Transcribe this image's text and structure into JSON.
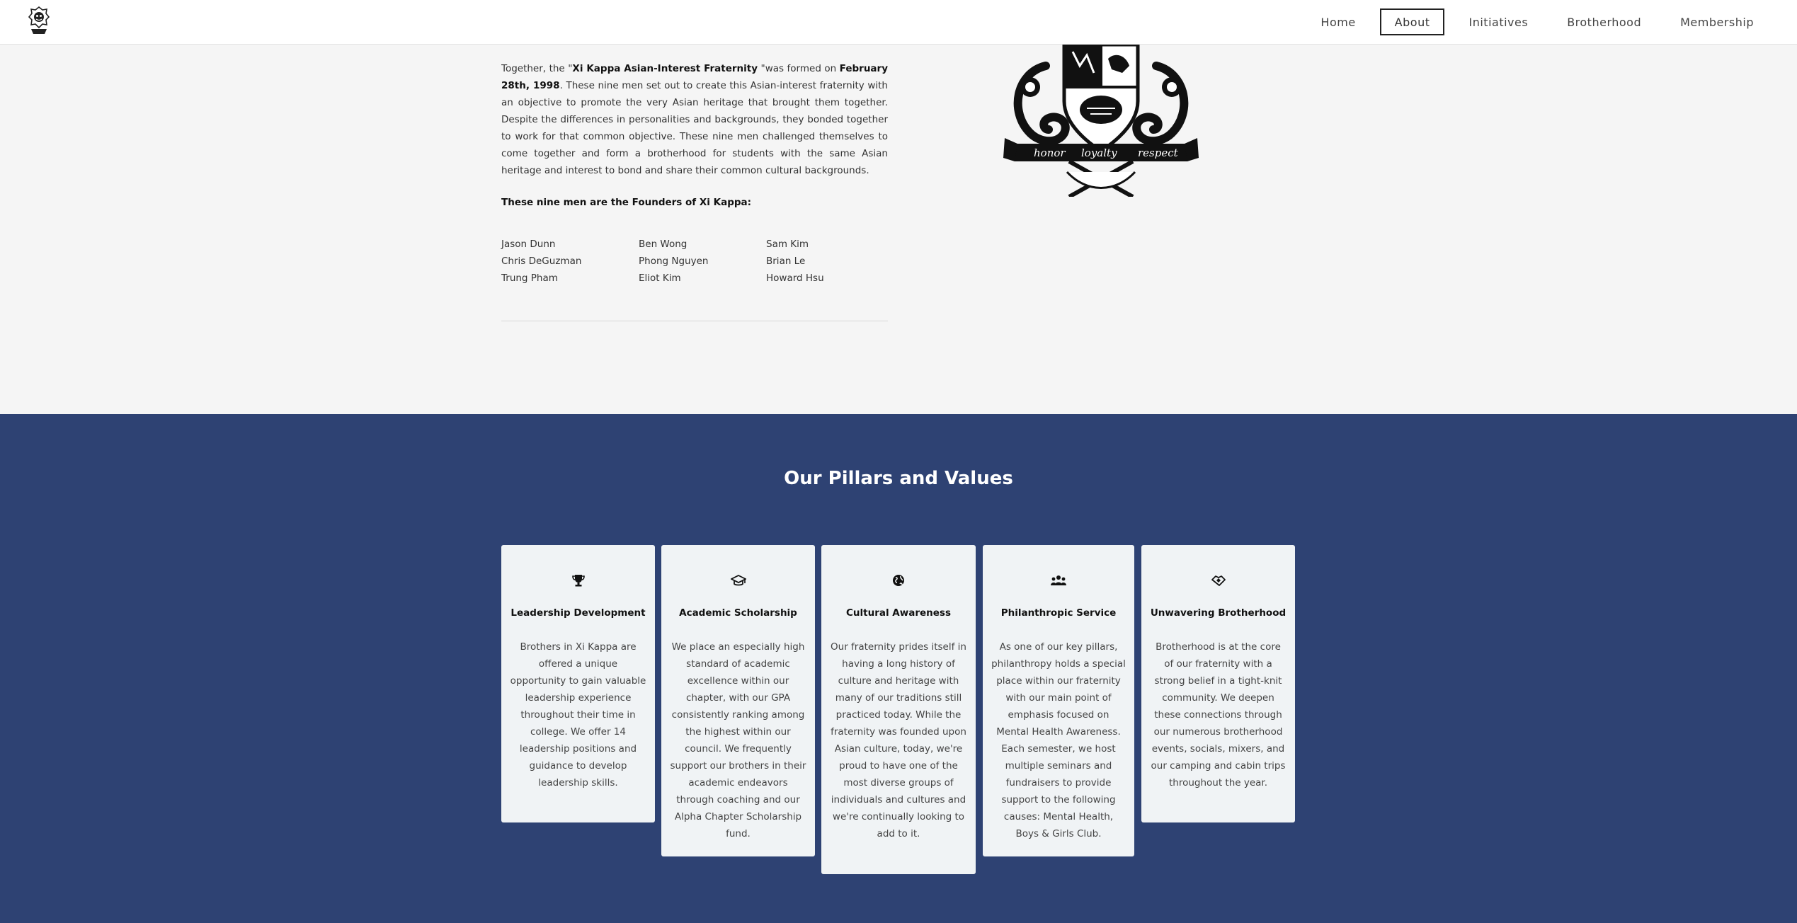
{
  "nav": {
    "items": [
      {
        "label": "Home",
        "active": false
      },
      {
        "label": "About",
        "active": true
      },
      {
        "label": "Initiatives",
        "active": false
      },
      {
        "label": "Brotherhood",
        "active": false
      },
      {
        "label": "Membership",
        "active": false
      }
    ]
  },
  "about": {
    "intro_pre": "Together, the \"",
    "org_name": "Xi Kappa Asian-Interest Fraternity",
    "intro_mid": " \"was formed on ",
    "date": "February 28th, 1998",
    "intro_rest": ". These nine men set out to create this Asian-interest fraternity with an objective to promote the very Asian heritage that brought them together.  Despite the differences in personalities and backgrounds, they bonded together to work for that common objective. These nine men challenged themselves to come together and form a brotherhood for students with the same Asian heritage and interest to bond and share their common cultural backgrounds.",
    "founders_heading": "These nine men are the Founders of Xi Kappa:",
    "founders": [
      "Jason Dunn",
      "Chris DeGuzman",
      "Trung Pham",
      "Ben Wong",
      "Phong Nguyen",
      "Eliot Kim",
      "Sam Kim",
      "Brian Le",
      "Howard Hsu"
    ],
    "crest": {
      "banner_words": [
        "honor",
        "loyalty",
        "respect"
      ]
    }
  },
  "pillars": {
    "title": "Our Pillars and Values",
    "cards": [
      {
        "icon": "trophy-icon",
        "title": "Leadership Development",
        "body": "Brothers in Xi Kappa are offered a unique opportunity to gain valuable leadership experience throughout their time in college. We offer 14 leadership positions and guidance to develop leadership skills."
      },
      {
        "icon": "graduation-cap-icon",
        "title": "Academic Scholarship",
        "body": "We place an especially high standard of academic excellence within our chapter, with our GPA consistently ranking among the highest within our council. We frequently support our brothers in their academic endeavors through coaching and our Alpha Chapter Scholarship fund."
      },
      {
        "icon": "globe-icon",
        "title": "Cultural Awareness",
        "body": "Our fraternity prides itself in having a long history of culture and heritage with many of our traditions still practiced today. While the fraternity was founded upon Asian culture, today, we're proud to have one of the most diverse groups of individuals and cultures and we're continually looking to add to it."
      },
      {
        "icon": "people-group-icon",
        "title": "Philanthropic Service",
        "body": "As one of our key pillars, philanthropy holds a special place within our fraternity with our main point of emphasis focused on Mental Health Awareness. Each semester, we host multiple seminars and fundraisers to provide support to the following causes: Mental Health, Boys & Girls Club."
      },
      {
        "icon": "handshake-icon",
        "title": "Unwavering Brotherhood",
        "body": "Brotherhood is at the core of our fraternity with a strong belief in a tight-knit community. We deepen these connections through our numerous brotherhood events, socials, mixers, and our camping and cabin trips throughout the year."
      }
    ]
  },
  "colors": {
    "pillars_bg": "#2e4273",
    "card_bg": "#f0f3f5",
    "header_bg": "#ffffff",
    "page_bg": "#f5f5f5"
  }
}
